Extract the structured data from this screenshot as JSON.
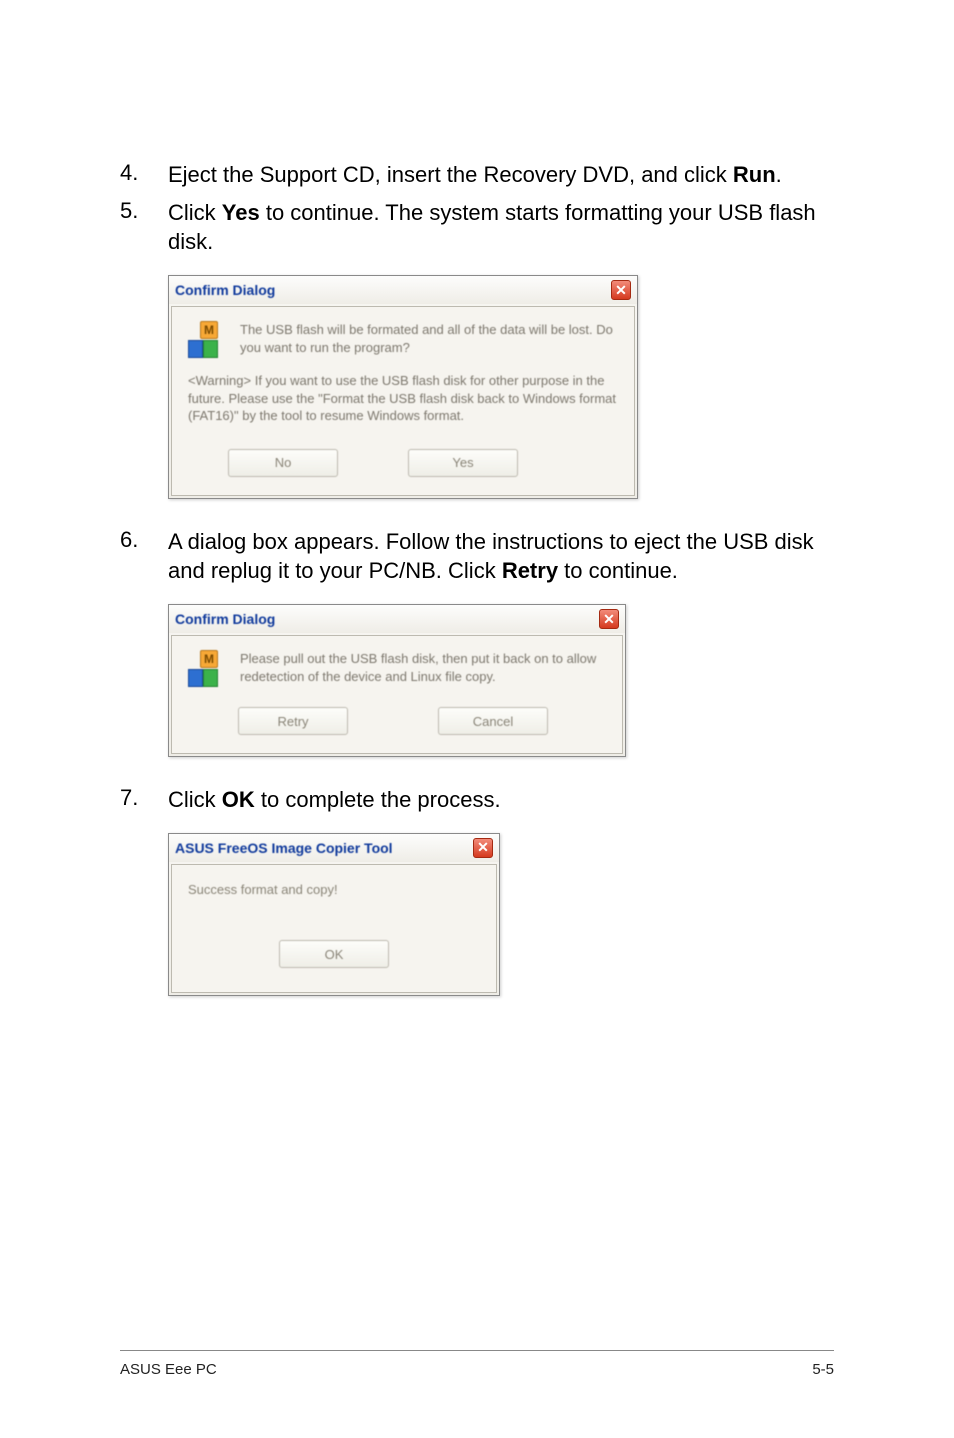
{
  "steps": {
    "4": {
      "num": "4.",
      "text_pre": "Eject the Support CD, insert the Recovery DVD, and click ",
      "bold": "Run",
      "text_post": "."
    },
    "5": {
      "num": "5.",
      "text_pre": "Click ",
      "bold": "Yes",
      "text_post": " to continue. The system starts formatting your USB flash disk."
    },
    "6": {
      "num": "6.",
      "text_pre": "A dialog box appears. Follow the instructions to eject the USB disk and replug it to your PC/NB. Click ",
      "bold": "Retry",
      "text_post": " to continue."
    },
    "7": {
      "num": "7.",
      "text_pre": "Click ",
      "bold": "OK",
      "text_post": " to complete the process."
    }
  },
  "dialog1": {
    "title": "Confirm Dialog",
    "message": "The USB flash will be formated and all of the data will be lost. Do you want to run the program?",
    "warning": "<Warning> If you want to use the USB flash disk for other purpose in the future. Please use the \"Format the USB flash disk back to Windows format (FAT16)\" by the tool to resume Windows format.",
    "btn_no": "No",
    "btn_yes": "Yes"
  },
  "dialog2": {
    "title": "Confirm Dialog",
    "message": "Please pull out the USB flash disk, then put it back on to allow redetection of the device and Linux file copy.",
    "btn_retry": "Retry",
    "btn_cancel": "Cancel"
  },
  "dialog3": {
    "title": "ASUS FreeOS Image Copier Tool",
    "message": "Success format and copy!",
    "btn_ok": "OK"
  },
  "close_x": "✕",
  "footer": {
    "left": "ASUS Eee PC",
    "right": "5-5"
  }
}
